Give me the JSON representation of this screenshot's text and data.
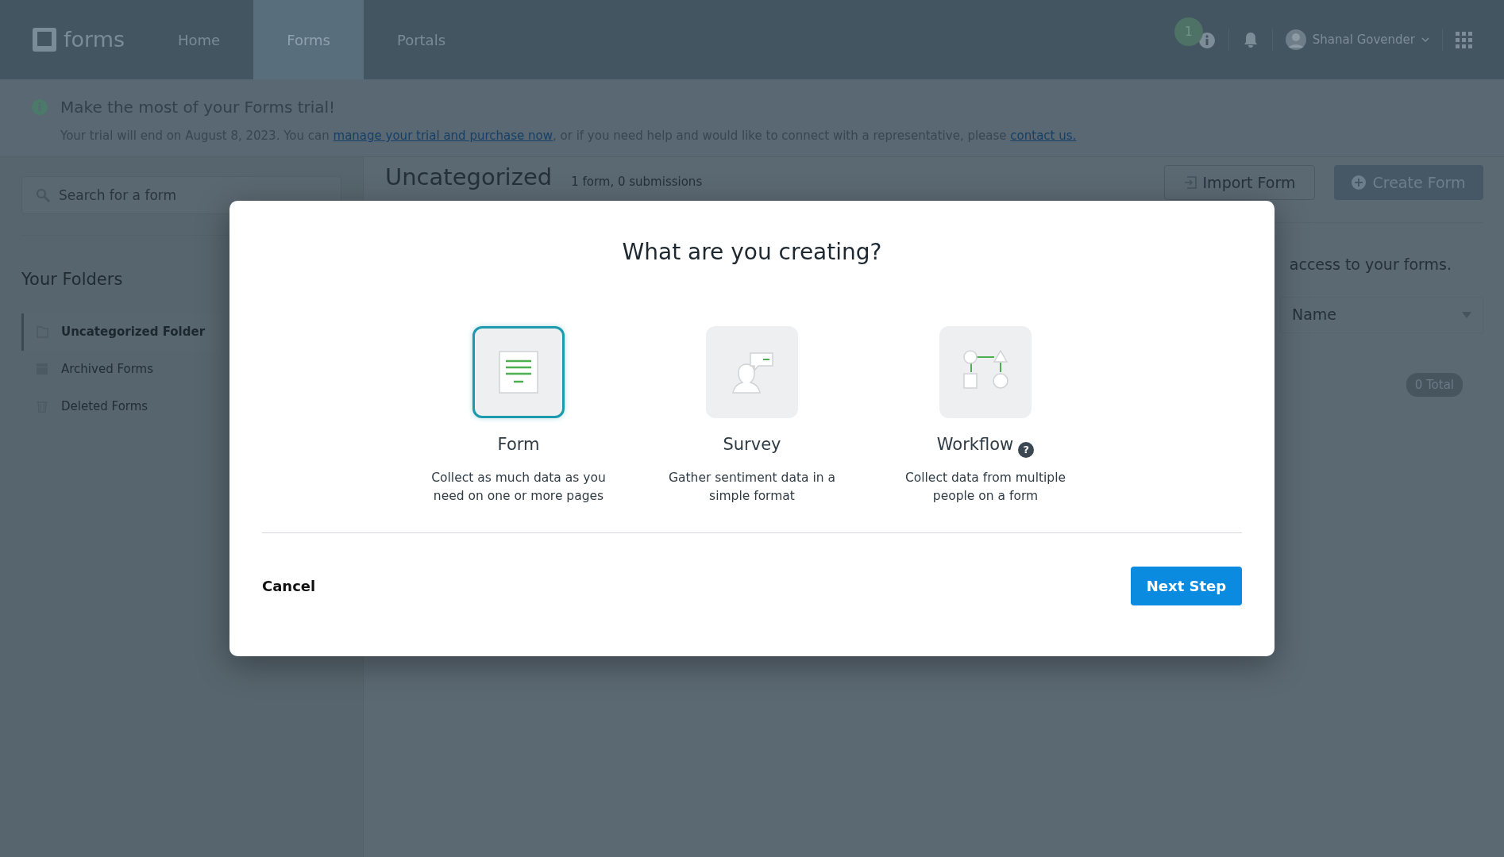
{
  "navbar": {
    "logo": "forms",
    "tabs": [
      {
        "label": "Home",
        "selected": false
      },
      {
        "label": "Forms",
        "selected": true
      },
      {
        "label": "Portals",
        "selected": false
      }
    ],
    "notification_count": "1",
    "user_name": "Shanal Govender"
  },
  "banner": {
    "title": "Make the most of your Forms trial!",
    "text_start": "Your trial will end on August 8, 2023. You can ",
    "link_purchase": "manage your trial and purchase now",
    "text_middle": ", or if you need help and would like to connect with a representative, please ",
    "link_contact": "contact us."
  },
  "sidebar": {
    "search": {
      "placeholder": "Search for a form"
    },
    "heading": "Your Folders",
    "items": [
      {
        "kind": "folder",
        "label": "Uncategorized Folder",
        "selected": true
      },
      {
        "kind": "archive",
        "label": "Archived Forms",
        "selected": false
      },
      {
        "kind": "trash",
        "label": "Deleted Forms",
        "selected": false
      }
    ]
  },
  "main": {
    "title": "Uncategorized",
    "subtitle": "1 form, 0 submissions",
    "import_button": "Import Form",
    "create_button": "Create Form",
    "notice": "access to your forms.",
    "sort": "Name",
    "total": "0 Total"
  },
  "modal": {
    "title": "What are you creating?",
    "options": [
      {
        "kind": "form",
        "label": "Form",
        "description": "Collect as much data as you need on one or more pages",
        "selected": true
      },
      {
        "kind": "survey",
        "label": "Survey",
        "description": "Gather sentiment data in a simple format",
        "selected": false
      },
      {
        "kind": "workflow",
        "label": "Workflow",
        "description": "Collect data from multiple people on a form",
        "selected": false,
        "help": "?"
      }
    ],
    "cancel": "Cancel",
    "next": "Next Step"
  }
}
